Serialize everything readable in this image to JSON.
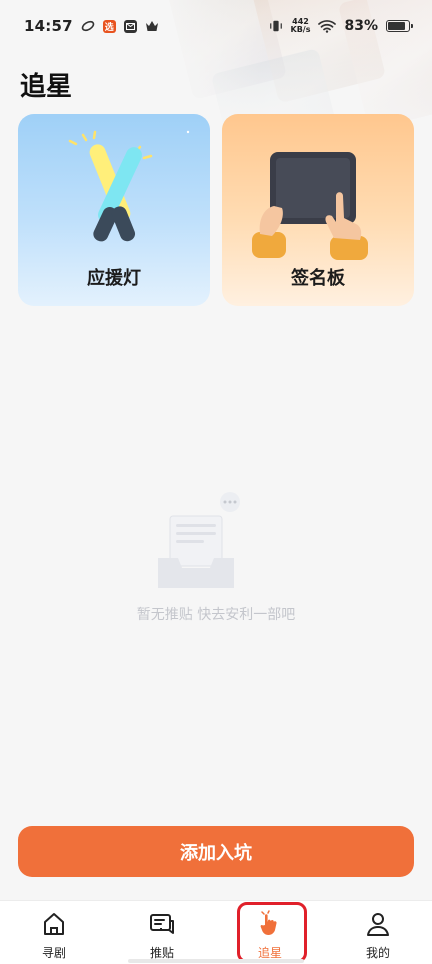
{
  "status_bar": {
    "time": "14:57",
    "app_badge": "选",
    "net_speed_value": "442",
    "net_speed_unit": "KB/s",
    "battery_percent": "83%",
    "battery_level": 0.83,
    "icons": [
      "lens-icon",
      "app-badge-icon",
      "mail-icon",
      "crown-icon",
      "vibrate-icon",
      "wifi-icon",
      "battery-icon"
    ]
  },
  "page": {
    "title": "追星"
  },
  "cards": [
    {
      "label": "应援灯",
      "icon": "lightstick-icon"
    },
    {
      "label": "签名板",
      "icon": "signboard-icon"
    }
  ],
  "empty_state": {
    "text": "暂无推贴 快去安利一部吧",
    "icon": "empty-inbox-icon"
  },
  "add_button": {
    "label": "添加入坑"
  },
  "bottom_nav": {
    "active_index": 2,
    "items": [
      {
        "label": "寻剧",
        "icon": "home-icon"
      },
      {
        "label": "推贴",
        "icon": "message-icon"
      },
      {
        "label": "追星",
        "icon": "hand-icon"
      },
      {
        "label": "我的",
        "icon": "profile-icon"
      }
    ]
  },
  "colors": {
    "accent": "#f0703a",
    "highlight": "#e0202a",
    "lightstick_card": "#9fd0f7",
    "signboard_card": "#ffc78e"
  }
}
